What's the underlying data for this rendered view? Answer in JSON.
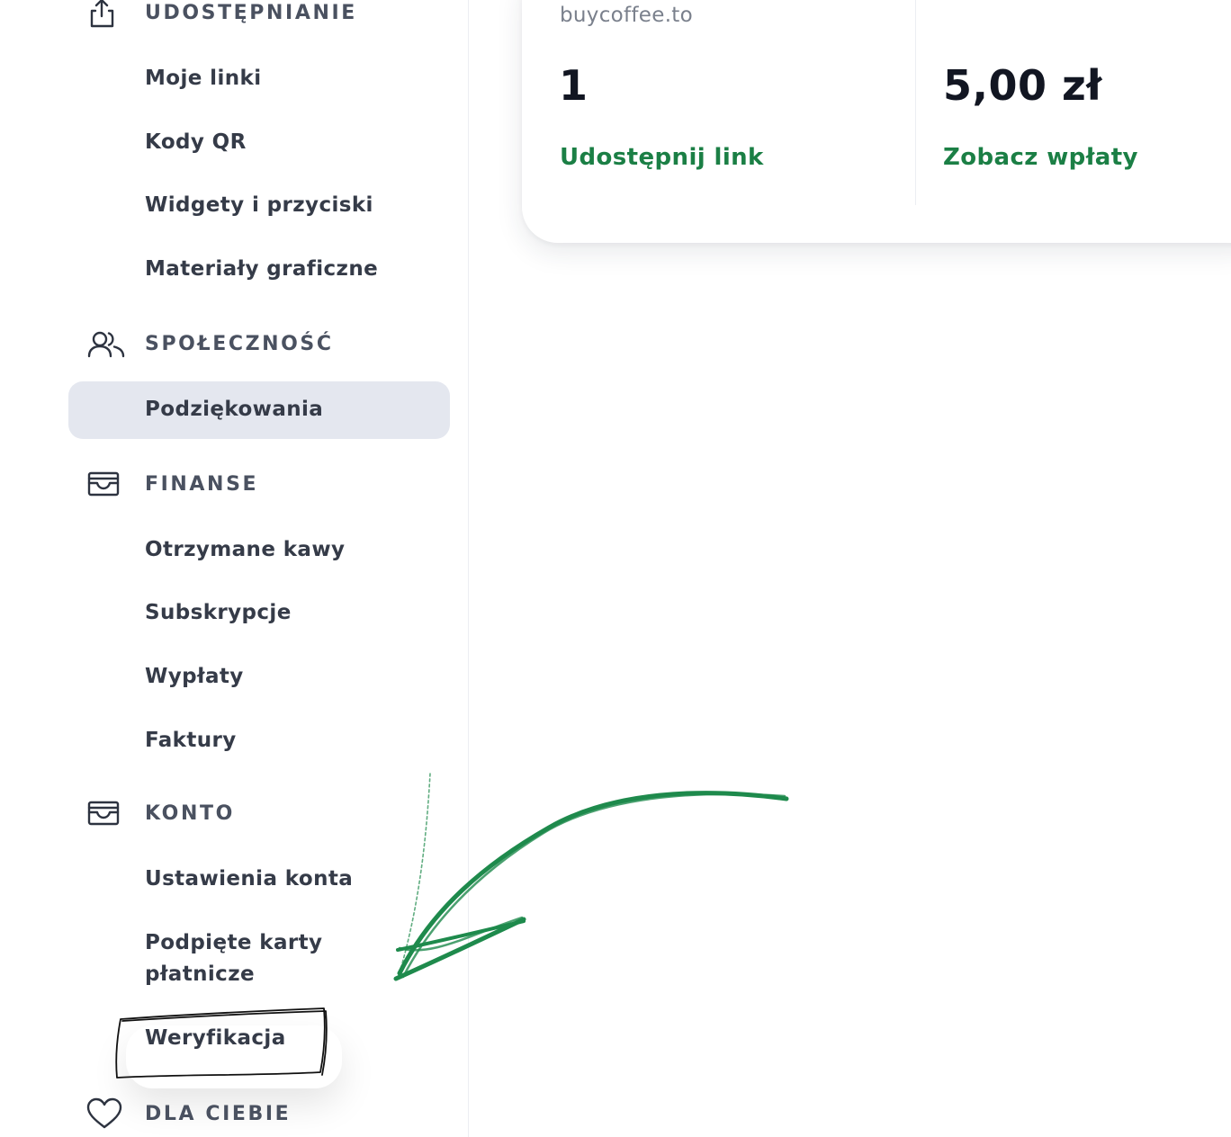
{
  "sidebar": {
    "sections": {
      "sharing": {
        "label": "UDOSTĘPNIANIE",
        "icon": "share-icon"
      },
      "community": {
        "label": "SPOŁECZNOŚĆ",
        "icon": "users-icon"
      },
      "finance": {
        "label": "FINANSE",
        "icon": "wallet-icon"
      },
      "account": {
        "label": "KONTO",
        "icon": "wallet-icon"
      },
      "for_you": {
        "label": "DLA CIEBIE",
        "icon": "heart-icon"
      }
    },
    "items": {
      "my_links": "Moje linki",
      "qr_codes": "Kody QR",
      "widgets": "Widgety i przyciski",
      "graphics": "Materiały graficzne",
      "thanks": "Podziękowania",
      "received_coffees": "Otrzymane kawy",
      "subscriptions": "Subskrypcje",
      "payouts": "Wypłaty",
      "invoices": "Faktury",
      "account_settings": "Ustawienia konta",
      "saved_cards": "Podpięte karty płatnicze",
      "verification": "Weryfikacja"
    },
    "active_item": "Podziękowania"
  },
  "card": {
    "source": "buycoffee.to",
    "supporters_count": "1",
    "amount": "5,00 zł",
    "share_link": "Udostępnij link",
    "view_payments": "Zobacz wpłaty"
  },
  "colors": {
    "accent_green": "#1b7f45",
    "annotation_green": "#1e8a4c",
    "active_bg": "#e4e7ef"
  }
}
